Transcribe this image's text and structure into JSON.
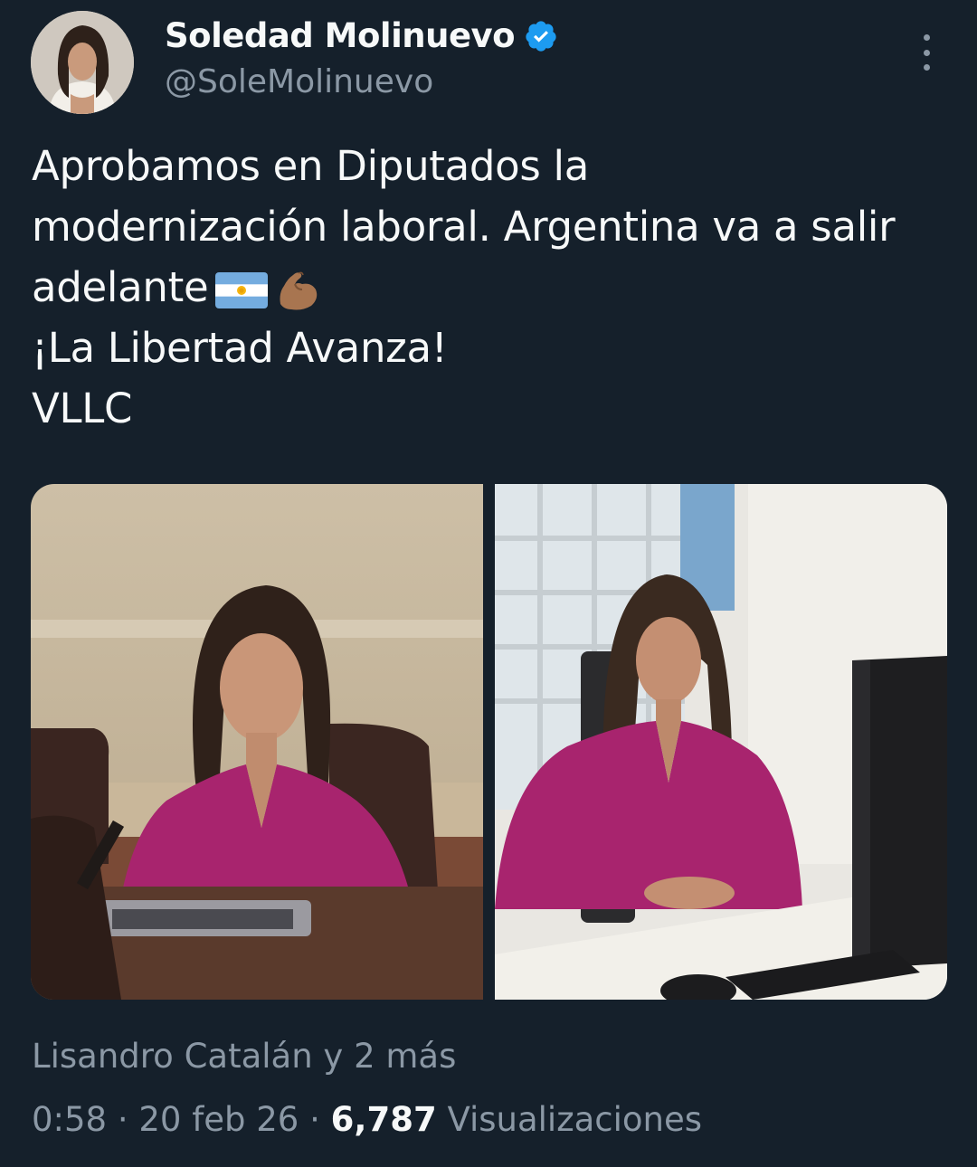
{
  "author": {
    "name": "Soledad Molinuevo",
    "handle": "@SoleMolinuevo",
    "verified": true,
    "avatar_icon": "profile-photo"
  },
  "more_icon": "more-vertical-icon",
  "tweet": {
    "lines": [
      "Aprobamos en Diputados la",
      "modernización laboral. Argentina va a salir",
      "adelante",
      "¡La Libertad Avanza!",
      "VLLC"
    ],
    "emojis": [
      "flag-argentina-emoji",
      "flexed-biceps-emoji"
    ]
  },
  "media": [
    {
      "icon": "photo-chamber-seat"
    },
    {
      "icon": "photo-office-desk"
    }
  ],
  "social_context": "Lisandro Catalán y 2 más",
  "meta": {
    "time": "0:58",
    "date": "20 feb 26",
    "separator": "·",
    "views_count": "6,787",
    "views_label": "Visualizaciones"
  },
  "colors": {
    "background": "#15202b",
    "text": "#f7f9f9",
    "secondary": "#8b98a5",
    "verified": "#1d9bf0",
    "blouse": "#a8246e"
  }
}
